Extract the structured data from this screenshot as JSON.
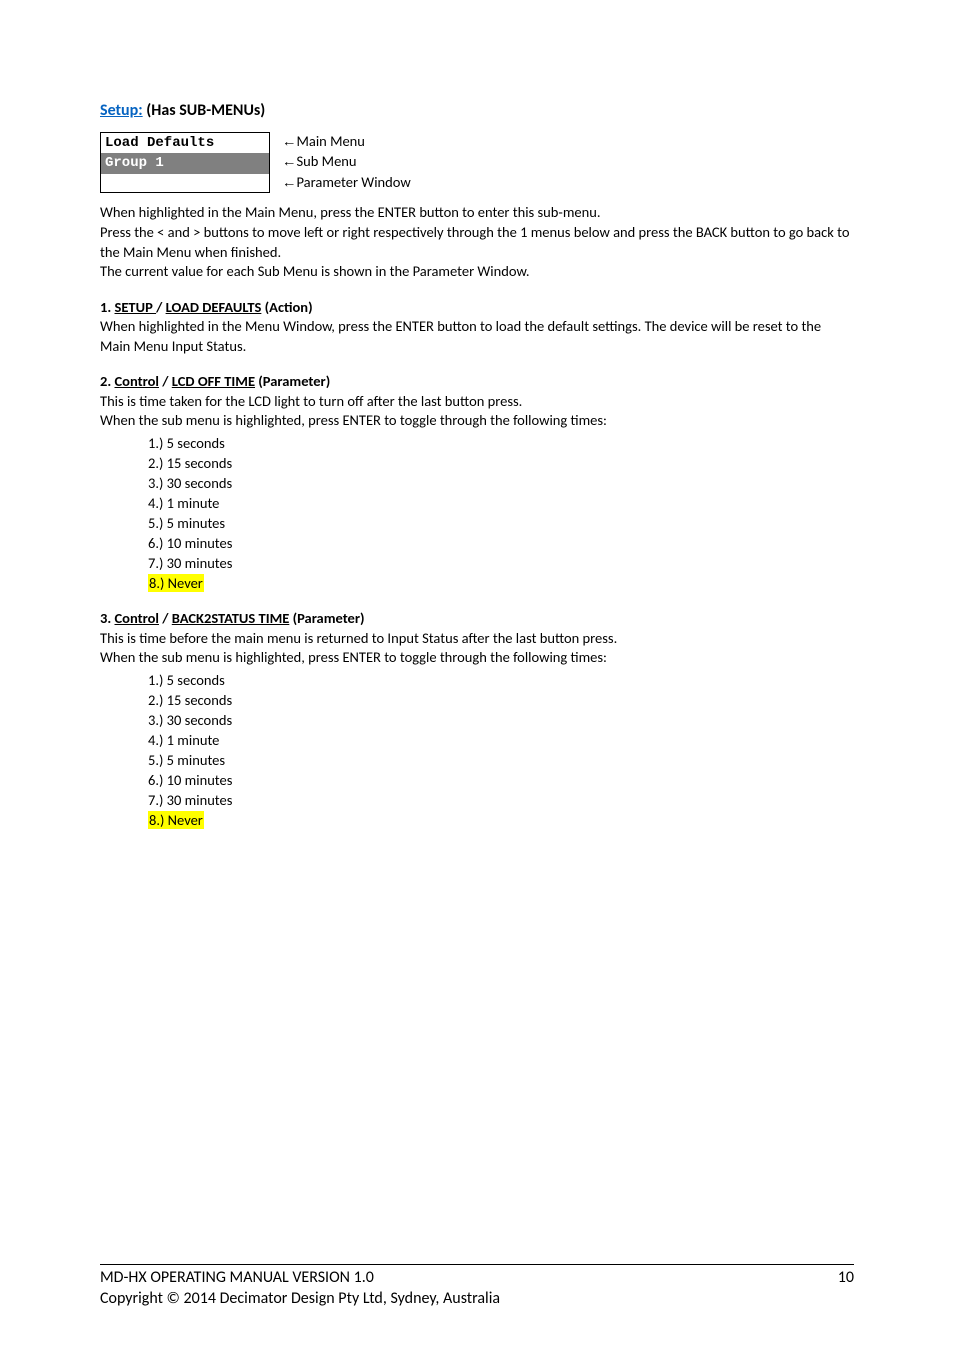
{
  "title": {
    "link": "Setup:",
    "rest": " (Has SUB-MENUs)"
  },
  "lcd": {
    "line1": "Load Defaults",
    "line2": "Group 1"
  },
  "legend": {
    "main": "Main Menu",
    "sub": "Sub Menu",
    "param": "Parameter Window"
  },
  "intro": [
    "When highlighted in the Main Menu, press the ENTER button to enter this sub-menu.",
    "Press the < and > buttons to move left or right respectively through the 1 menus below and press the BACK button to go back to the Main Menu when finished.",
    "The current value for each Sub Menu is shown in the Parameter Window."
  ],
  "s1": {
    "num": "1. ",
    "path1": "SETUP ",
    "sep": "/ ",
    "path2": "LOAD DEFAULTS",
    "tag": " (Action)",
    "body": "When highlighted in the Menu Window, press the ENTER button to load the default settings.  The device will be reset to the Main Menu Input Status."
  },
  "s2": {
    "num": "2. ",
    "path1": "Control",
    "sep": " / ",
    "path2": "LCD OFF TIME",
    "tag": " (Parameter)",
    "body1": "This is time taken for the LCD light to turn off after the last button press.",
    "body2": "When the sub menu is highlighted, press ENTER to toggle through the following times:",
    "items": [
      {
        "n": "1.)",
        "t": "5 seconds"
      },
      {
        "n": "2.)",
        "t": "15 seconds"
      },
      {
        "n": "3.)",
        "t": "30 seconds"
      },
      {
        "n": "4.)",
        "t": "1 minute"
      },
      {
        "n": "5.)",
        "t": "5 minutes"
      },
      {
        "n": "6.)",
        "t": "10 minutes"
      },
      {
        "n": "7.)",
        "t": "30 minutes"
      },
      {
        "n": "8.)",
        "t": "Never",
        "hl": true
      }
    ]
  },
  "s3": {
    "num": "3. ",
    "path1": "Control",
    "sep": " / ",
    "path2": "BACK2STATUS TIME",
    "tag": " (Parameter)",
    "body1": "This is time before the main menu is returned to Input Status after the last button press.",
    "body2": "When the sub menu is highlighted, press ENTER to toggle through the following times:",
    "items": [
      {
        "n": "1.)",
        "t": "5 seconds"
      },
      {
        "n": "2.)",
        "t": "15 seconds"
      },
      {
        "n": "3.)",
        "t": "30 seconds"
      },
      {
        "n": "4.)",
        "t": "1 minute"
      },
      {
        "n": "5.)",
        "t": "5 minutes"
      },
      {
        "n": "6.)",
        "t": "10 minutes"
      },
      {
        "n": "7.)",
        "t": "30 minutes"
      },
      {
        "n": "8.)",
        "t": "Never",
        "hl": true
      }
    ]
  },
  "footer": {
    "line1": "MD-HX OPERATING MANUAL VERSION 1.0",
    "page": "10",
    "line2": "Copyright © 2014 Decimator Design Pty Ltd, Sydney, Australia"
  },
  "glyph": {
    "arrow": "←"
  }
}
